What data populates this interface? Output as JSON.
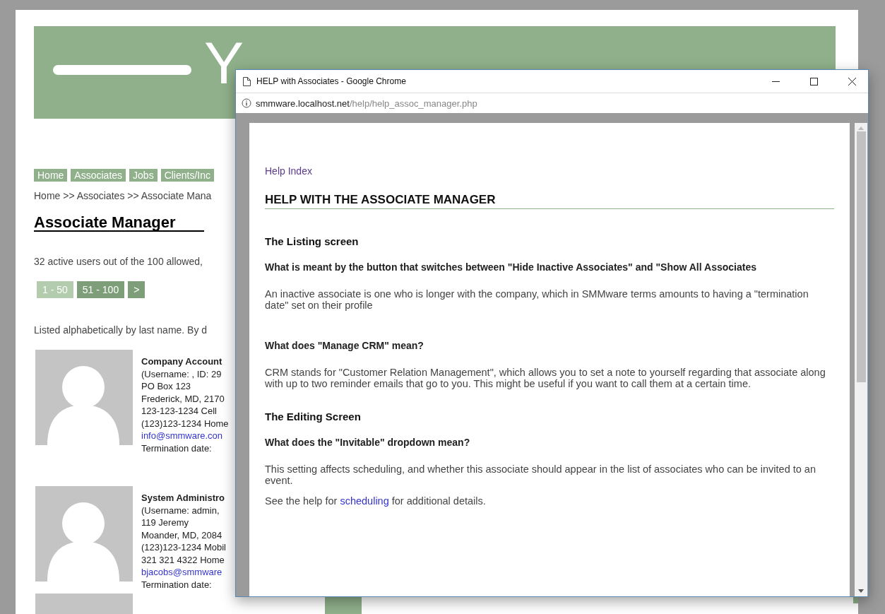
{
  "site": {
    "logo": "Y",
    "nav": [
      {
        "label": "Home"
      },
      {
        "label": "Associates"
      },
      {
        "label": "Jobs"
      },
      {
        "label": "Clients/Inc"
      }
    ],
    "breadcrumb": "Home >> Associates >> Associate Mana",
    "title": "Associate Manager",
    "summary": "32 active users out of the 100 allowed,",
    "pager": [
      {
        "label": "1 - 50",
        "selected": true
      },
      {
        "label": "51 - 100",
        "selected": false
      },
      {
        "label": ">",
        "selected": false
      }
    ],
    "sort_note": "Listed alphabetically by last name. By d",
    "associates": [
      {
        "name": "Company Account",
        "lines": [
          "(Username: , ID: 29",
          "PO Box 123",
          "Frederick, MD, 2170",
          "123-123-1234 Cell",
          "(123)123-1234 Home"
        ],
        "email": "info@smmware.con",
        "termination": "Termination date:"
      },
      {
        "name": "System Administro",
        "lines": [
          "(Username: admin,",
          "119 Jeremy",
          "Moander, MD, 2084",
          "(123)123-1234 Mobil",
          "321 321 4322 Home"
        ],
        "email": "bjacobs@smmware",
        "termination": "Termination date:"
      }
    ]
  },
  "help_window": {
    "title": "HELP with Associates - Google Chrome",
    "url_host": "smmware.localhost.net",
    "url_path": "/help/help_assoc_manager.php",
    "index_link": "Help Index",
    "heading": "HELP WITH THE ASSOCIATE MANAGER",
    "blocks": [
      {
        "kind": "section",
        "text": "The Listing screen"
      },
      {
        "kind": "question",
        "text": "What is meant by the button that switches between \"Hide Inactive Associates\" and \"Show All Associates"
      },
      {
        "kind": "para",
        "text": "An inactive associate is one who is longer with the company, which in SMMware terms amounts to having a \"termination date\" set on their profile"
      },
      {
        "kind": "question",
        "text": "What does \"Manage CRM\" mean?"
      },
      {
        "kind": "para",
        "text": "CRM stands for \"Customer Relation Management\", which allows you to set a note to yourself regarding that associate along with up to two reminder emails that go to you. This might be useful if you want to call them at a certain time."
      },
      {
        "kind": "section",
        "text": "The Editing Screen"
      },
      {
        "kind": "question",
        "text": "What does the \"Invitable\" dropdown mean?"
      },
      {
        "kind": "para",
        "text": "This setting affects scheduling, and whether this associate should appear in the list of associates who can be invited to an event."
      },
      {
        "kind": "link_para",
        "before": "See the help for",
        "link": "scheduling",
        "after": "for additional details."
      }
    ]
  }
}
